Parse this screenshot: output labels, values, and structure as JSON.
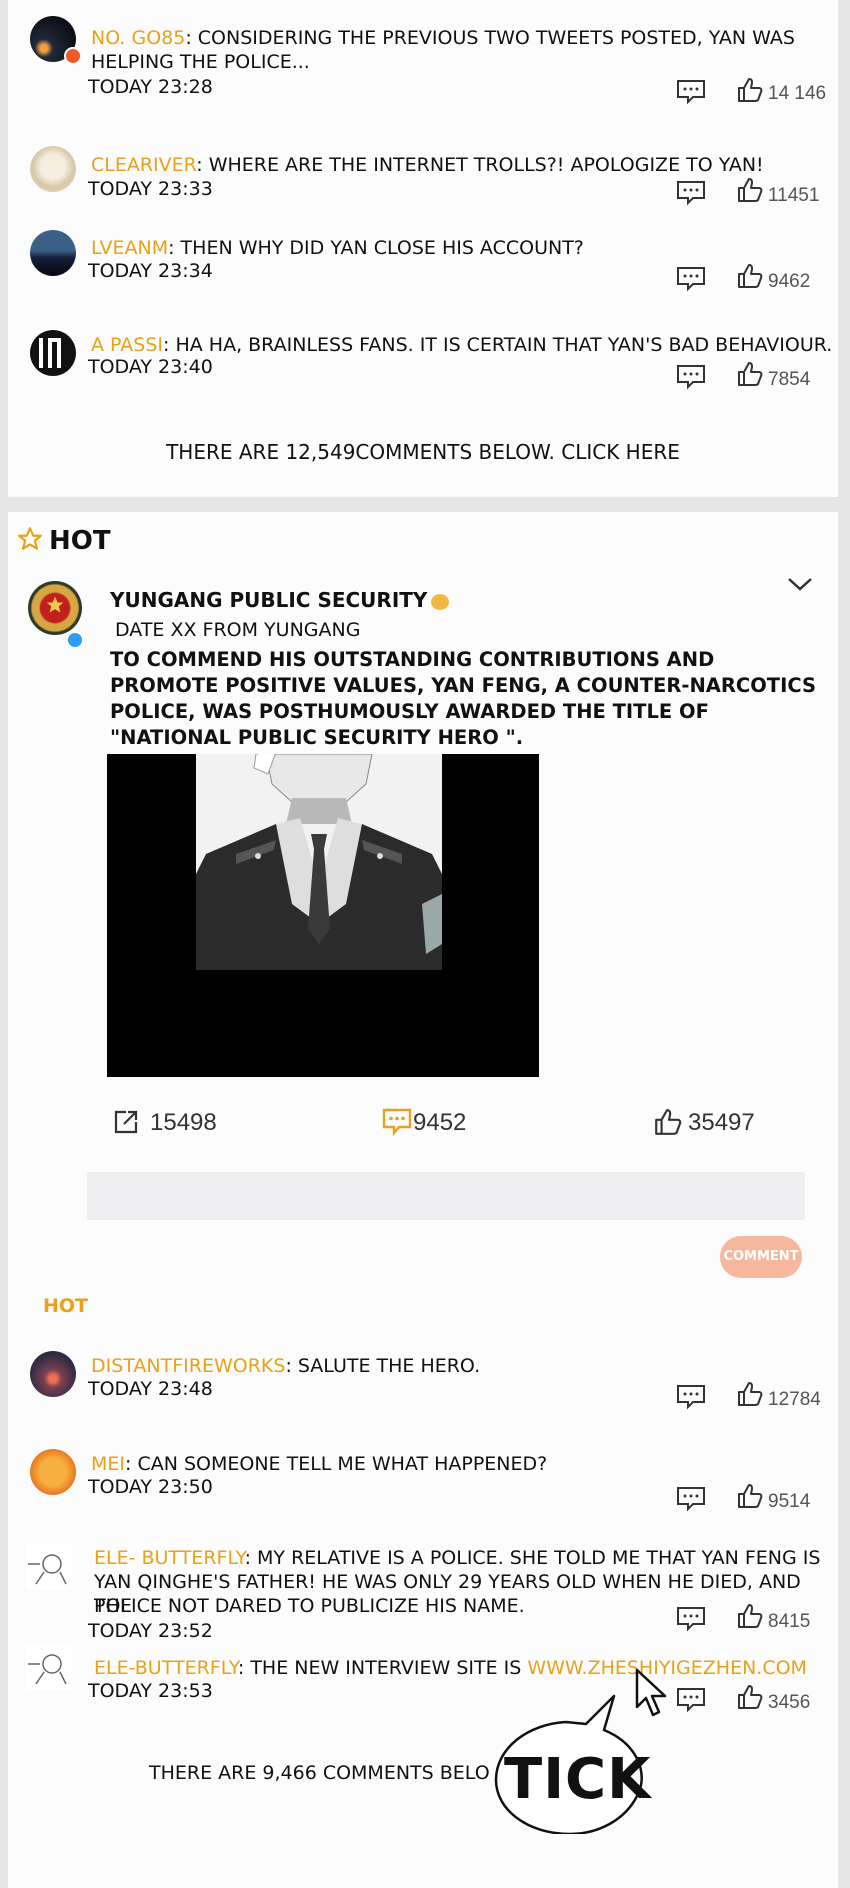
{
  "top_comments": [
    {
      "user": "NO. GO85",
      "line1": ": CONSIDERING THE PREVIOUS TWO TWEETS POSTED, YAN WAS",
      "line2": "HELPING THE POLICE...",
      "time": "TODAY 23:28",
      "likes": "14 146"
    },
    {
      "user": "CLEARIVER",
      "line1": ": WHERE ARE THE INTERNET TROLLS?! APOLOGIZE TO YAN!",
      "time": "TODAY 23:33",
      "likes": "11451"
    },
    {
      "user": "LVEANM",
      "line1": ":  THEN WHY DID YAN CLOSE HIS ACCOUNT?",
      "time": "TODAY 23:34",
      "likes": "9462"
    },
    {
      "user": "A PASSI",
      "line1": ": HA HA, BRAINLESS FANS. IT IS CERTAIN THAT YAN'S BAD BEHAVIOUR.",
      "time": "TODAY 23:40",
      "likes": "7854"
    }
  ],
  "top_more": "THERE ARE 12,549COMMENTS BELOW. CLICK HERE",
  "hot_header": "HOT",
  "post": {
    "author": "YUNGANG PUBLIC SECURITY",
    "date": "DATE XX FROM YUNGANG",
    "body": [
      "TO COMMEND HIS OUTSTANDING CONTRIBUTIONS AND",
      "PROMOTE POSITIVE VALUES, YAN FENG, A COUNTER-NARCOTICS",
      "POLICE, WAS POSTHUMOUSLY AWARDED THE TITLE OF",
      "\"NATIONAL PUBLIC SECURITY HERO \"."
    ],
    "shares": "15498",
    "comments": "9452",
    "likes": "35497"
  },
  "comment_button": "COMMENT",
  "hot_label": "HOT",
  "hot_comments": [
    {
      "user": "DISTANTFIREWORKS",
      "line1": ": SALUTE THE HERO.",
      "time": "TODAY 23:48",
      "likes": "12784"
    },
    {
      "user": "MEI",
      "line1": ": CAN SOMEONE TELL ME WHAT HAPPENED?",
      "time": "TODAY 23:50",
      "likes": "9514"
    },
    {
      "user": "ELE- BUTTERFLY",
      "line1": ": MY RELATIVE IS A POLICE. SHE TOLD ME THAT YAN FENG IS",
      "line2": "YAN QINGHE'S FATHER! HE WAS ONLY 29 YEARS OLD WHEN HE DIED, AND THE",
      "line3": "POLICE NOT DARED TO PUBLICIZE HIS NAME.",
      "time": "TODAY 23:52",
      "likes": "8415"
    },
    {
      "user": "ELE-BUTTERFLY",
      "line1": ": THE NEW INTERVIEW SITE IS ",
      "link": "WWW.ZHESHIYIGEZHEN.COM",
      "time": "TODAY 23:53",
      "likes": "3456"
    }
  ],
  "hot_more": "THERE ARE 9,466 COMMENTS BELO",
  "sfx": "TICK",
  "colors": {
    "username": "#e8a11a",
    "comment_btn": "#f6b89c",
    "comment_icon": "#e8a11a"
  }
}
